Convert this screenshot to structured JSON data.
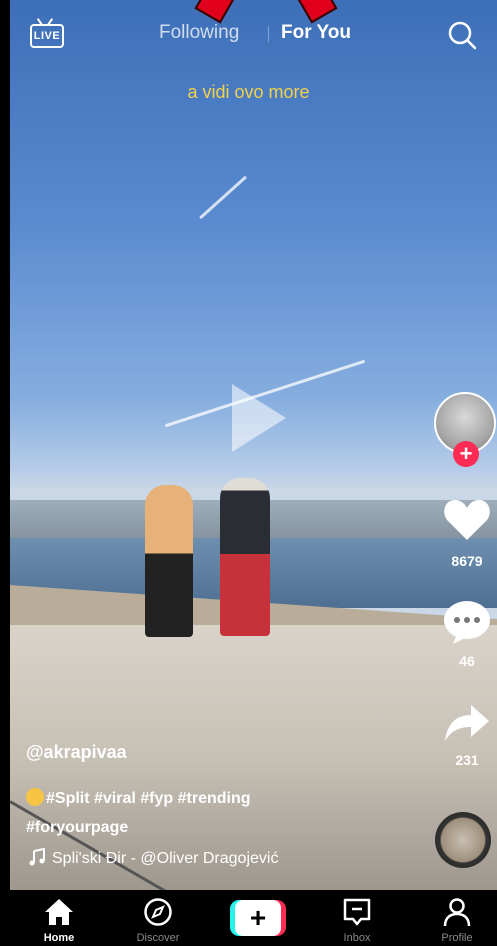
{
  "header": {
    "live_label": "LIVE",
    "tabs": [
      {
        "label": "Following",
        "active": false
      },
      {
        "label": "For You",
        "active": true
      }
    ]
  },
  "video": {
    "caption": "a vidi ovo more"
  },
  "sidebar": {
    "likes": "8679",
    "comments": "46",
    "shares": "231"
  },
  "post": {
    "username": "@akrapivaa",
    "hashtags_line1": "#Split #viral #fyp #trending",
    "hashtags_line2": "#foryourpage",
    "sound": "Spli'ski Đir - @Oliver Dragojević"
  },
  "nav": {
    "items": [
      {
        "label": "Home",
        "icon": "home-icon"
      },
      {
        "label": "Discover",
        "icon": "compass-icon"
      },
      {
        "label": "Inbox",
        "icon": "inbox-icon"
      },
      {
        "label": "Profile",
        "icon": "profile-icon"
      }
    ]
  },
  "colors": {
    "accent": "#fe2c55",
    "cyan": "#25f4ee",
    "caption": "#f2d24a"
  }
}
